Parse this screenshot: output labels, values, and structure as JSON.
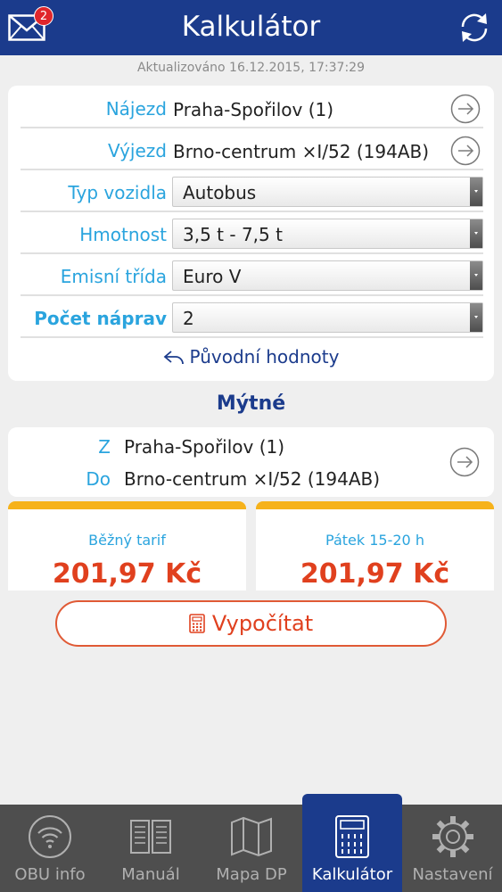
{
  "header": {
    "title": "Kalkulátor",
    "unread_count": "2"
  },
  "updated": "Aktualizováno 16.12.2015, 17:37:29",
  "form": {
    "entry": {
      "label": "Nájezd",
      "value": "Praha-Spořilov (1)"
    },
    "exit": {
      "label": "Výjezd",
      "value": "Brno-centrum ×I/52 (194AB)"
    },
    "vehicle_type": {
      "label": "Typ vozidla",
      "value": "Autobus"
    },
    "weight": {
      "label": "Hmotnost",
      "value": "3,5 t - 7,5 t"
    },
    "emission": {
      "label": "Emisní třída",
      "value": "Euro V"
    },
    "axles": {
      "label": "Počet náprav",
      "value": "2"
    },
    "reset_label": "Původní hodnoty"
  },
  "toll": {
    "title": "Mýtné",
    "from_label": "Z",
    "from_value": "Praha-Spořilov (1)",
    "to_label": "Do",
    "to_value": "Brno-centrum ×I/52 (194AB)",
    "tariff_regular": {
      "label": "Běžný tarif",
      "value": "201,97 Kč"
    },
    "tariff_friday": {
      "label": "Pátek 15-20 h",
      "value": "201,97 Kč"
    },
    "calculate_label": "Vypočítat"
  },
  "nav": {
    "items": [
      {
        "label": "OBU info"
      },
      {
        "label": "Manuál"
      },
      {
        "label": "Mapa DP"
      },
      {
        "label": "Kalkulátor"
      },
      {
        "label": "Nastavení"
      }
    ]
  },
  "colors": {
    "primary": "#1b3b8c",
    "label_blue": "#2aa4de",
    "accent_orange": "#e0401e",
    "tariff_bar": "#f6b21b"
  }
}
